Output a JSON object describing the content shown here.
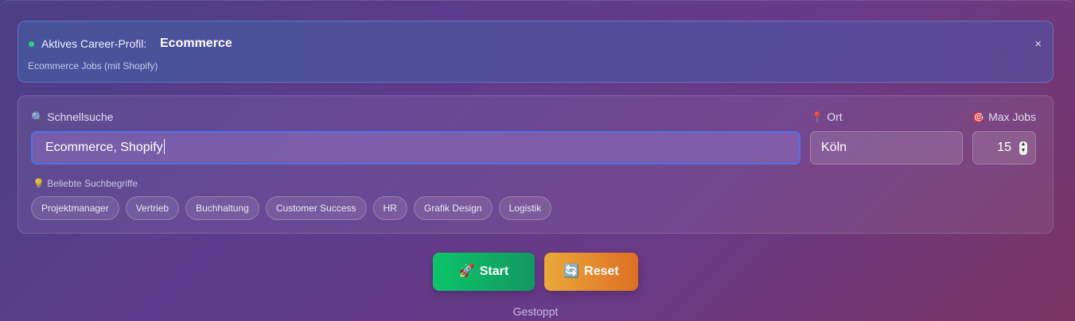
{
  "profile": {
    "label": "Aktives Career-Profil:",
    "name": "Ecommerce",
    "description": "Ecommerce Jobs (mit Shopify)",
    "close_icon": "×",
    "status_color": "#2fd17a"
  },
  "search": {
    "quick_label": "Schnellsuche",
    "quick_icon": "🔍",
    "quick_value": "Ecommerce, Shopify",
    "location_label": "Ort",
    "location_icon": "📍",
    "location_value": "Köln",
    "max_label": "Max Jobs",
    "max_icon": "🎯",
    "max_value": "15"
  },
  "suggestions": {
    "icon": "💡",
    "label": "Beliebte Suchbegriffe",
    "items": [
      "Projektmanager",
      "Vertrieb",
      "Buchhaltung",
      "Customer Success",
      "HR",
      "Grafik Design",
      "Logistik"
    ]
  },
  "actions": {
    "start_icon": "🚀",
    "start_label": "Start",
    "reset_icon": "🔄",
    "reset_label": "Reset"
  },
  "status": "Gestoppt",
  "colors": {
    "accent_focus": "#4d73e8",
    "start": "#0dc46a",
    "reset": "#eaa83a"
  }
}
